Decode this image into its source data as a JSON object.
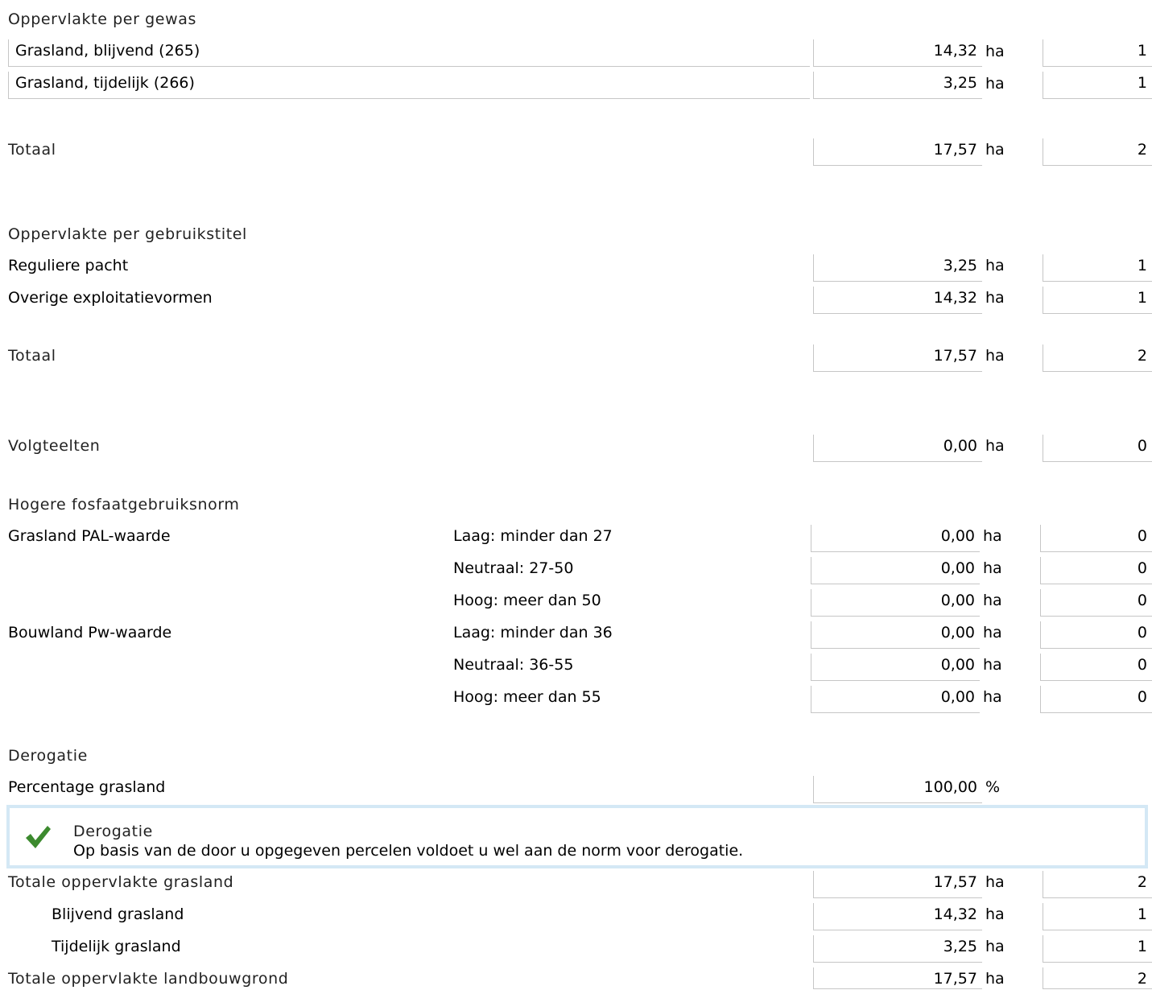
{
  "gewas": {
    "title": "Oppervlakte per gewas",
    "rows": [
      {
        "label": "Grasland, blijvend (265)",
        "value": "14,32",
        "unit": "ha",
        "count": "1"
      },
      {
        "label": "Grasland, tijdelijk (266)",
        "value": "3,25",
        "unit": "ha",
        "count": "1"
      }
    ],
    "total": {
      "label": "Totaal",
      "value": "17,57",
      "unit": "ha",
      "count": "2"
    }
  },
  "gebruikstitel": {
    "title": "Oppervlakte per gebruikstitel",
    "rows": [
      {
        "label": "Reguliere pacht",
        "value": "3,25",
        "unit": "ha",
        "count": "1"
      },
      {
        "label": "Overige exploitatievormen",
        "value": "14,32",
        "unit": "ha",
        "count": "1"
      }
    ],
    "total": {
      "label": "Totaal",
      "value": "17,57",
      "unit": "ha",
      "count": "2"
    }
  },
  "volgteelten": {
    "label": "Volgteelten",
    "value": "0,00",
    "unit": "ha",
    "count": "0"
  },
  "fosfaat": {
    "title": "Hogere fosfaatgebruiksnorm",
    "groups": [
      {
        "label": "Grasland PAL-waarde",
        "rows": [
          {
            "class": "Laag: minder dan 27",
            "value": "0,00",
            "unit": "ha",
            "count": "0"
          },
          {
            "class": "Neutraal: 27-50",
            "value": "0,00",
            "unit": "ha",
            "count": "0"
          },
          {
            "class": "Hoog: meer dan 50",
            "value": "0,00",
            "unit": "ha",
            "count": "0"
          }
        ]
      },
      {
        "label": "Bouwland Pw-waarde",
        "rows": [
          {
            "class": "Laag: minder dan 36",
            "value": "0,00",
            "unit": "ha",
            "count": "0"
          },
          {
            "class": "Neutraal: 36-55",
            "value": "0,00",
            "unit": "ha",
            "count": "0"
          },
          {
            "class": "Hoog: meer dan 55",
            "value": "0,00",
            "unit": "ha",
            "count": "0"
          }
        ]
      }
    ]
  },
  "derogatie": {
    "title": "Derogatie",
    "percentage": {
      "label": "Percentage grasland",
      "value": "100,00",
      "unit": "%"
    },
    "notice": {
      "icon": "check-icon",
      "color": "#3c8a2e",
      "title": "Derogatie",
      "body": "Op basis van de door u opgegeven percelen voldoet u wel aan de norm voor derogatie."
    }
  },
  "totals": {
    "grasland": {
      "label": "Totale oppervlakte grasland",
      "value": "17,57",
      "unit": "ha",
      "count": "2"
    },
    "blijvend": {
      "label": "Blijvend grasland",
      "value": "14,32",
      "unit": "ha",
      "count": "1"
    },
    "tijdelijk": {
      "label": "Tijdelijk grasland",
      "value": "3,25",
      "unit": "ha",
      "count": "1"
    },
    "landbouwgrond": {
      "label": "Totale oppervlakte landbouwgrond",
      "value": "17,57",
      "unit": "ha",
      "count": "2"
    }
  }
}
